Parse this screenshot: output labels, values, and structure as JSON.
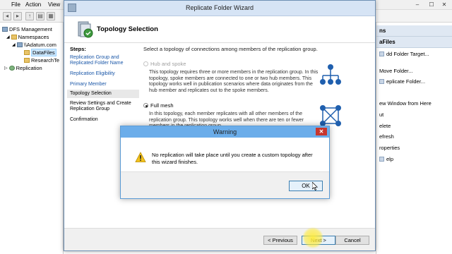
{
  "mmc": {
    "menus": [
      "File",
      "Action",
      "View"
    ],
    "tree": {
      "root": "DFS Management",
      "namespaces": "Namespaces",
      "namespace_path": "\\\\Adatum.com",
      "datafiles": "DataFiles",
      "researchte": "ResearchTe",
      "replication": "Replication"
    },
    "actions": {
      "header1": "ns",
      "header2": "aFiles",
      "items": [
        "dd Folder Target...",
        "Move Folder...",
        "eplicate Folder...",
        "ew Window from Here",
        "ut",
        "elete",
        "efresh",
        "roperties",
        "elp"
      ]
    }
  },
  "wizard": {
    "title": "Replicate Folder Wizard",
    "page_title": "Topology Selection",
    "steps_heading": "Steps:",
    "steps": [
      "Replication Group and Replicated Folder Name",
      "Replication Eligibility",
      "Primary Member",
      "Topology Selection",
      "Review Settings and Create Replication Group",
      "Confirmation"
    ],
    "instruction": "Select a topology of connections among members of the replication group.",
    "options": [
      {
        "label": "Hub and spoke",
        "description": "This topology requires three or more members in the replication group. In this topology, spoke members are connected to one or two hub members. This topology works well in publication scenarios where data originates from the hub member and replicates out to the spoke members."
      },
      {
        "label": "Full mesh",
        "description": "In this topology, each member replicates with all other members of the replication group. This topology works well when there are ten or fewer members in the replication group."
      }
    ],
    "buttons": {
      "previous": "< Previous",
      "next": "Next >",
      "cancel": "Cancel"
    }
  },
  "warning": {
    "title": "Warning",
    "message": "No replication will take place until you create a custom topology after this wizard finishes.",
    "ok": "OK"
  },
  "colors": {
    "warning_titlebar": "#6badea",
    "link": "#1a57a8",
    "close_button": "#c7362e",
    "cursor_highlight": "#ffeb3c"
  }
}
